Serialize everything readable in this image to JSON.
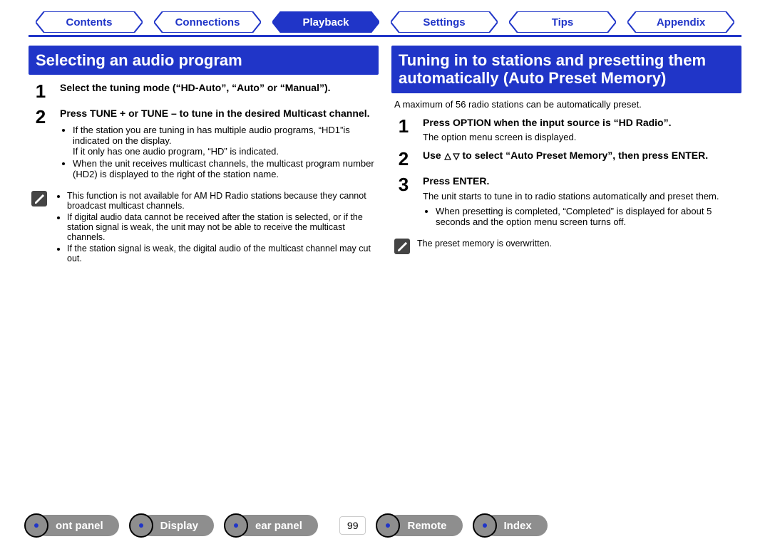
{
  "tabs": {
    "contents": {
      "label": "Contents",
      "active": false
    },
    "connections": {
      "label": "Connections",
      "active": false
    },
    "playback": {
      "label": "Playback",
      "active": true
    },
    "settings": {
      "label": "Settings",
      "active": false
    },
    "tips": {
      "label": "Tips",
      "active": false
    },
    "appendix": {
      "label": "Appendix",
      "active": false
    }
  },
  "left": {
    "heading": "Selecting an audio program",
    "steps": [
      {
        "num": "1",
        "title": "Select the tuning mode (“HD-Auto”, “Auto” or “Manual”)."
      },
      {
        "num": "2",
        "title": "Press TUNE + or TUNE – to tune in the desired Multicast channel.",
        "bullets": [
          "If the station you are tuning in has multiple audio programs, “HD1”is indicated on the display.\nIf it only has one audio program, “HD” is indicated.",
          "When the unit receives multicast channels, the multicast program number (HD2) is displayed to the right of the station name."
        ]
      }
    ],
    "notes": [
      "This function is not available for AM HD Radio stations because they cannot broadcast multicast channels.",
      "If digital audio data cannot be received after the station is selected, or if the station signal is weak, the unit may not be able to receive the multicast channels.",
      "If the station signal is weak, the digital audio of the multicast channel may cut out."
    ]
  },
  "right": {
    "heading": "Tuning in to stations and presetting them automatically (Auto Preset Memory)",
    "intro": "A maximum of 56 radio stations can be automatically preset.",
    "steps": [
      {
        "num": "1",
        "title": "Press OPTION when the input source is “HD Radio”.",
        "desc": "The option menu screen is displayed."
      },
      {
        "num": "2",
        "title_pre": "Use ",
        "title_post": " to select “Auto Preset Memory”, then press ENTER."
      },
      {
        "num": "3",
        "title": "Press ENTER.",
        "desc": "The unit starts to tune in to radio stations automatically and preset them.",
        "bullets": [
          "When presetting is completed, “Completed” is displayed for about 5 seconds and the option menu screen turns off."
        ]
      }
    ],
    "note": "The preset memory is overwritten."
  },
  "bottom": {
    "front_panel": "ont panel",
    "display": "Display",
    "rear_panel": "ear panel",
    "page": "99",
    "remote": "Remote",
    "index": "Index"
  }
}
